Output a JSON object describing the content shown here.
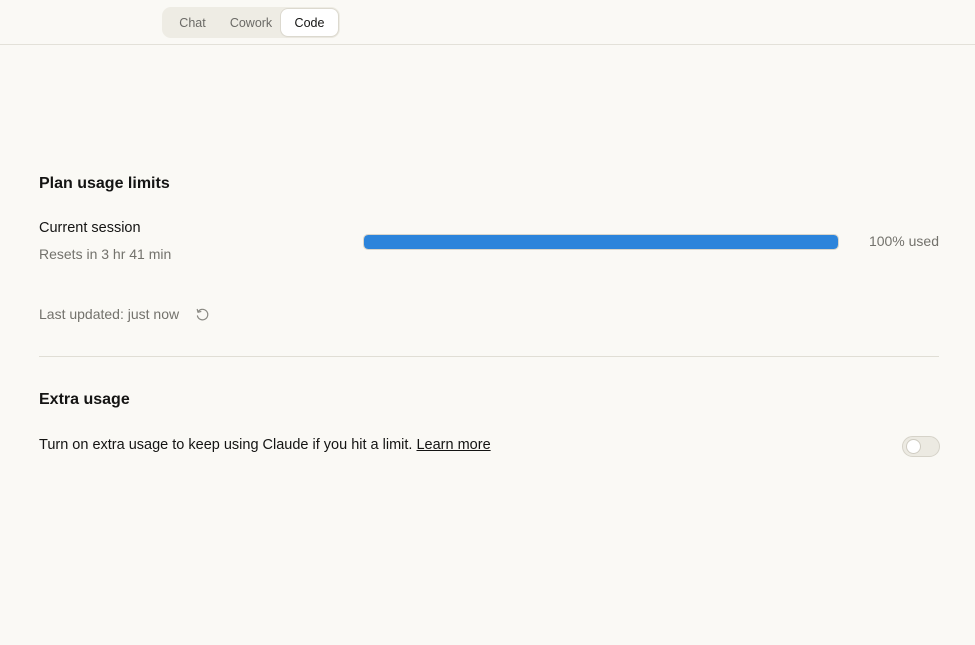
{
  "tabs": [
    {
      "label": "Chat",
      "active": false
    },
    {
      "label": "Cowork",
      "active": false
    },
    {
      "label": "Code",
      "active": true
    }
  ],
  "plan_usage": {
    "title": "Plan usage limits",
    "current_session": {
      "label": "Current session",
      "reset_text": "Resets in 3 hr 41 min",
      "percent_used": 100,
      "usage_text": "100% used"
    },
    "last_updated": "Last updated: just now",
    "refresh_icon": "refresh-icon"
  },
  "extra_usage": {
    "title": "Extra usage",
    "description": "Turn on extra usage to keep using Claude if you hit a limit.",
    "link_label": "Learn more",
    "enabled": false
  },
  "colors": {
    "background": "#faf9f5",
    "progress": "#2c84db",
    "muted_text": "#73726c"
  }
}
